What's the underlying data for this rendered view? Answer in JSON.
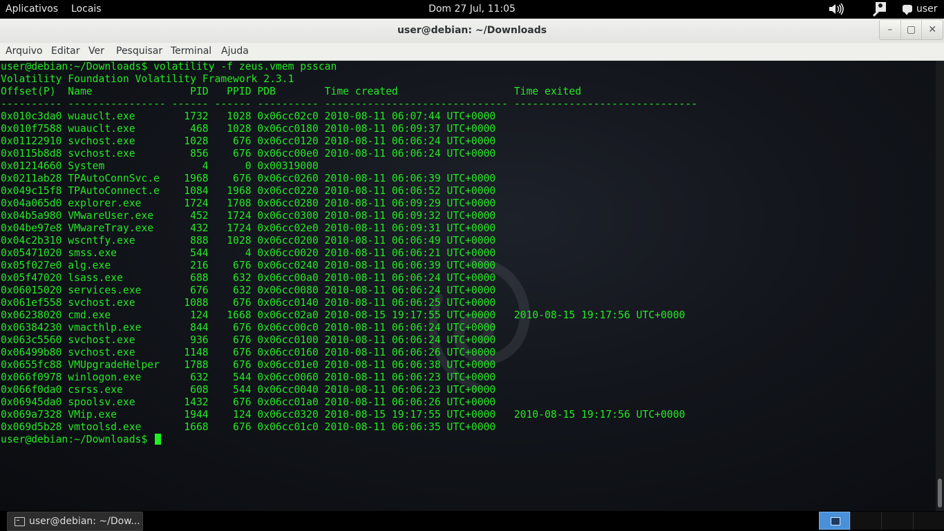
{
  "topbar": {
    "apps": "Aplicativos",
    "places": "Locais",
    "clock": "Dom 27 Jul, 11:05",
    "volume_icon": "volume-icon",
    "accessibility_icon": "accessibility-icon",
    "user": "user"
  },
  "window": {
    "title": "user@debian: ~/Downloads",
    "buttons": {
      "minimize": "–",
      "maximize": "▢",
      "close": "✕"
    }
  },
  "menu": [
    "Arquivo",
    "Editar",
    "Ver",
    "Pesquisar",
    "Terminal",
    "Ajuda"
  ],
  "terminal": {
    "lines": [
      "user@debian:~/Downloads$ volatility -f zeus.vmem psscan",
      "Volatility Foundation Volatility Framework 2.3.1",
      "Offset(P) Name PID PPID PDB Time created Time exited",
      "---------- ---------------- ------ ------ ---------- ------------------------------ ------------------------------",
      "0x010c3da0 wuauclt.exe 1732 1028 0x06cc02c0 2010-08-11 06:07:44 UTC+0000",
      "0x010f7588 wuauclt.exe 468 1028 0x06cc0180 2010-08-11 06:09:37 UTC+0000",
      "0x01122910 svchost.exe 1028 676 0x06cc0120 2010-08-11 06:06:24 UTC+0000",
      "0x0115b8d8 svchost.exe 856 676 0x06cc00e0 2010-08-11 06:06:24 UTC+0000",
      "0x01214660 System 4 0 0x00319000",
      "0x0211ab28 TPAutoConnSvc.e 1968 676 0x06cc0260 2010-08-11 06:06:39 UTC+0000",
      "0x049c15f8 TPAutoConnect.e 1084 1968 0x06cc0220 2010-08-11 06:06:52 UTC+0000",
      "0x04a065d0 explorer.exe 1724 1708 0x06cc0280 2010-08-11 06:09:29 UTC+0000",
      "0x04b5a980 VMwareUser.exe 452 1724 0x06cc0300 2010-08-11 06:09:32 UTC+0000",
      "0x04be97e8 VMwareTray.exe 432 1724 0x06cc02e0 2010-08-11 06:09:31 UTC+0000",
      "0x04c2b310 wscntfy.exe 888 1028 0x06cc0200 2010-08-11 06:06:49 UTC+0000",
      "0x05471020 smss.exe 544 4 0x06cc0020 2010-08-11 06:06:21 UTC+0000",
      "0x05f027e0 alg.exe 216 676 0x06cc0240 2010-08-11 06:06:39 UTC+0000",
      "0x05f47020 lsass.exe 688 632 0x06cc00a0 2010-08-11 06:06:24 UTC+0000",
      "0x06015020 services.exe 676 632 0x06cc0080 2010-08-11 06:06:24 UTC+0000",
      "0x061ef558 svchost.exe 1088 676 0x06cc0140 2010-08-11 06:06:25 UTC+0000",
      "0x06238020 cmd.exe 124 1668 0x06cc02a0 2010-08-15 19:17:55 UTC+0000 2010-08-15 19:17:56 UTC+0000",
      "0x06384230 vmacthlp.exe 844 676 0x06cc00c0 2010-08-11 06:06:24 UTC+0000",
      "0x063c5560 svchost.exe 936 676 0x06cc0100 2010-08-11 06:06:24 UTC+0000",
      "0x06499b80 svchost.exe 1148 676 0x06cc0160 2010-08-11 06:06:26 UTC+0000",
      "0x0655fc88 VMUpgradeHelper 1788 676 0x06cc01e0 2010-08-11 06:06:38 UTC+0000",
      "0x066f0978 winlogon.exe 632 544 0x06cc0060 2010-08-11 06:06:23 UTC+0000",
      "0x066f0da0 csrss.exe 608 544 0x06cc0040 2010-08-11 06:06:23 UTC+0000",
      "0x06945da0 spoolsv.exe 1432 676 0x06cc01a0 2010-08-11 06:06:26 UTC+0000",
      "0x069a7328 VMip.exe 1944 124 0x06cc0320 2010-08-15 19:17:55 UTC+0000 2010-08-15 19:17:56 UTC+0000",
      "0x069d5b28 vmtoolsd.exe 1668 676 0x06cc01c0 2010-08-11 06:06:35 UTC+0000"
    ],
    "prompt": "user@debian:~/Downloads$ ",
    "text_color": "#26e726"
  },
  "taskbar": {
    "task_label": "user@debian: ~/Dow...",
    "task_icon": "terminal-icon"
  }
}
